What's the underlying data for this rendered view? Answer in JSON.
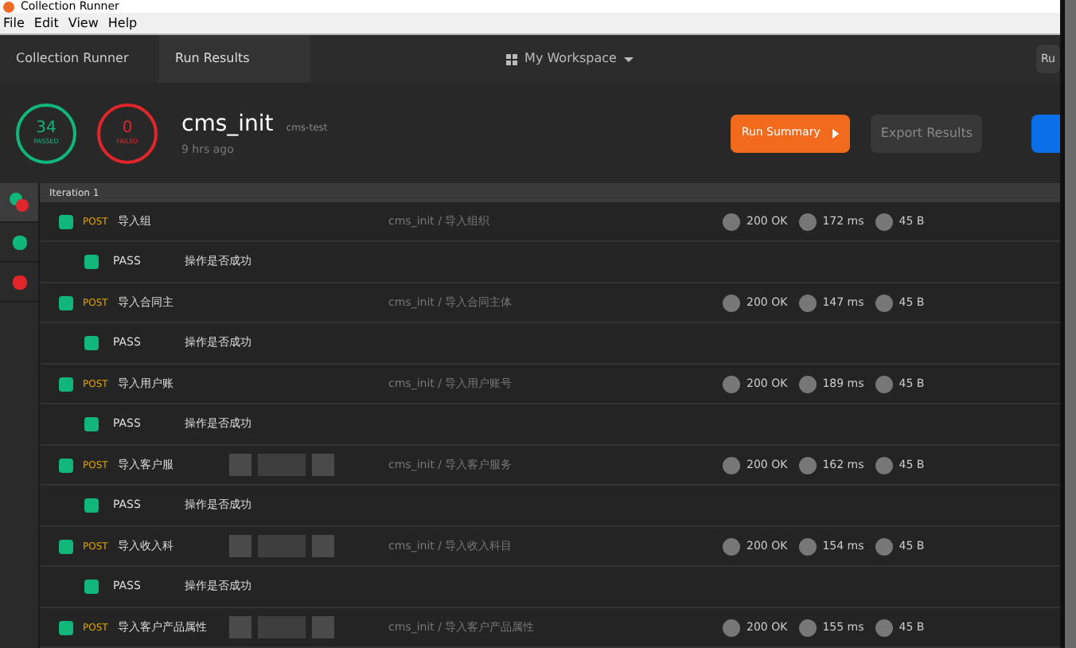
{
  "window": {
    "title": "Collection Runner"
  },
  "menu": [
    "File",
    "Edit",
    "View",
    "Help"
  ],
  "breadcrumbs": [
    {
      "label": "Collection Runner",
      "selected": false
    },
    {
      "label": "Run Results",
      "selected": true
    }
  ],
  "workspace": {
    "label": "My Workspace"
  },
  "top_right_button": "Ru",
  "summary": {
    "passed": {
      "count": "34",
      "label": "PASSED"
    },
    "failed": {
      "count": "0",
      "label": "FAILED"
    },
    "collection": "cms_init",
    "environment": "cms-test",
    "time": "9 hrs ago"
  },
  "actions": {
    "run_summary": "Run Summary",
    "export": "Export Results"
  },
  "filters": [
    {
      "kind": "all",
      "selected": true
    },
    {
      "kind": "passed",
      "selected": false
    },
    {
      "kind": "failed",
      "selected": false
    }
  ],
  "iteration": "Iteration 1",
  "requests": [
    {
      "method": "POST",
      "name": "导入组",
      "path": "cms_init / 导入组织",
      "passed": true,
      "status": "200 OK",
      "time": "172 ms",
      "size": "45 B",
      "redacted": false,
      "tests": [
        {
          "result": "PASS",
          "name": "操作是否成功",
          "passed": true
        }
      ]
    },
    {
      "method": "POST",
      "name": "导入合同主",
      "path": "cms_init / 导入合同主体",
      "passed": true,
      "status": "200 OK",
      "time": "147 ms",
      "size": "45 B",
      "redacted": false,
      "tests": [
        {
          "result": "PASS",
          "name": "操作是否成功",
          "passed": true
        }
      ]
    },
    {
      "method": "POST",
      "name": "导入用户账",
      "path": "cms_init / 导入用户账号",
      "passed": true,
      "status": "200 OK",
      "time": "189 ms",
      "size": "45 B",
      "redacted": false,
      "tests": [
        {
          "result": "PASS",
          "name": "操作是否成功",
          "passed": true
        }
      ]
    },
    {
      "method": "POST",
      "name": "导入客户服",
      "path": "cms_init / 导入客户服务",
      "passed": true,
      "status": "200 OK",
      "time": "162 ms",
      "size": "45 B",
      "redacted": true,
      "tests": [
        {
          "result": "PASS",
          "name": "操作是否成功",
          "passed": true
        }
      ]
    },
    {
      "method": "POST",
      "name": "导入收入科",
      "path": "cms_init / 导入收入科目",
      "passed": true,
      "status": "200 OK",
      "time": "154 ms",
      "size": "45 B",
      "redacted": true,
      "tests": [
        {
          "result": "PASS",
          "name": "操作是否成功",
          "passed": true
        }
      ]
    },
    {
      "method": "POST",
      "name": "导入客户产品属性",
      "path": "cms_init / 导入客户产品属性",
      "passed": true,
      "status": "200 OK",
      "time": "155 ms",
      "size": "45 B",
      "redacted": true
    }
  ]
}
